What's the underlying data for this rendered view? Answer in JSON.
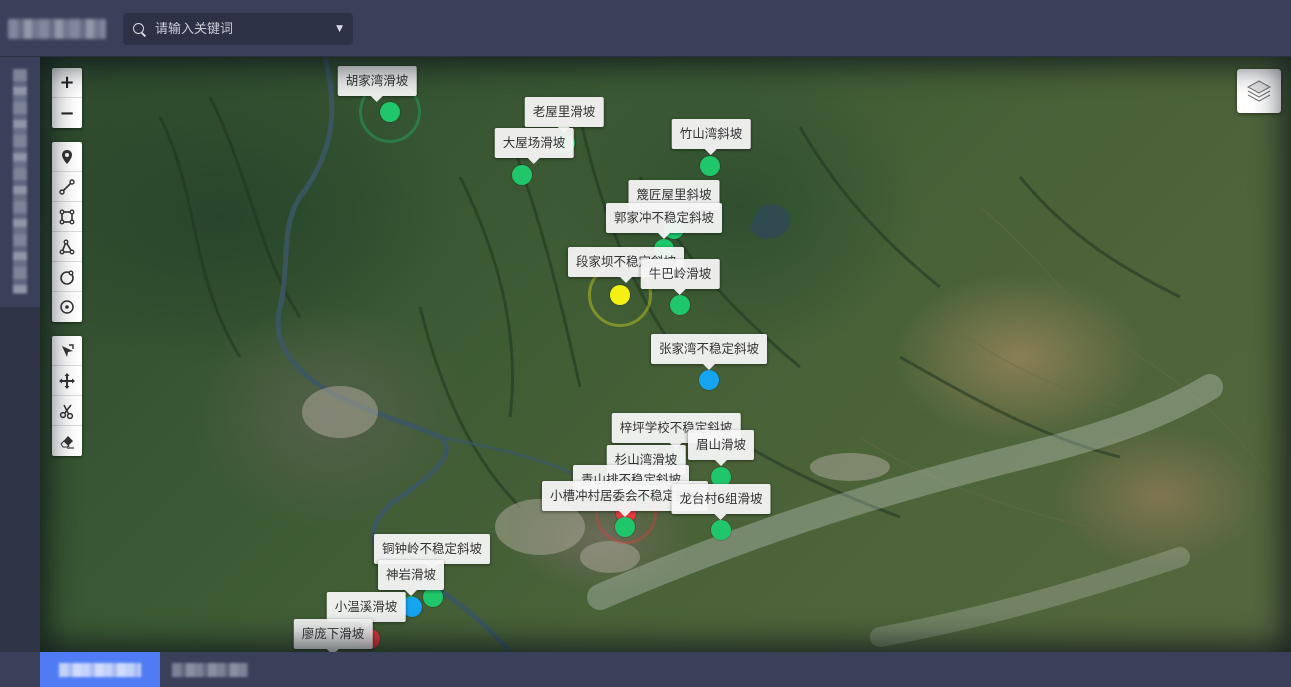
{
  "search": {
    "placeholder": "请输入关键词"
  },
  "map_controls": {
    "zoom": [
      "zoom-in",
      "zoom-out"
    ],
    "draw_tools": [
      "point",
      "line",
      "rectangle",
      "polygon",
      "circle",
      "circle-point"
    ],
    "edit_tools": [
      "select",
      "move",
      "cut",
      "erase"
    ]
  },
  "markers": [
    {
      "name": "胡家湾滑坡",
      "status": "green"
    },
    {
      "name": "老屋里滑坡",
      "status": "green"
    },
    {
      "name": "大屋场滑坡",
      "status": "green"
    },
    {
      "name": "竹山湾斜坡",
      "status": "green"
    },
    {
      "name": "篾匠屋里斜坡",
      "status": "green"
    },
    {
      "name": "郭家冲不稳定斜坡",
      "status": "green"
    },
    {
      "name": "段家坝不稳定斜坡",
      "status": "yellow"
    },
    {
      "name": "牛巴岭滑坡",
      "status": "green"
    },
    {
      "name": "张家湾不稳定斜坡",
      "status": "blue"
    },
    {
      "name": "梓坪学校不稳定斜坡",
      "status": "green"
    },
    {
      "name": "眉山滑坡",
      "status": "green"
    },
    {
      "name": "杉山湾滑坡",
      "status": "green"
    },
    {
      "name": "青山排不稳定斜坡",
      "status": "red"
    },
    {
      "name": "小槽冲村居委会不稳定斜坡",
      "status": "green"
    },
    {
      "name": "龙台村6组滑坡",
      "status": "green"
    },
    {
      "name": "铜钟岭不稳定斜坡",
      "status": "green"
    },
    {
      "name": "神岩滑坡",
      "status": "green"
    },
    {
      "name": "小温溪滑坡",
      "status": "blue"
    },
    {
      "name": "廖庞下滑坡",
      "status": "red"
    }
  ],
  "colors": {
    "green": "#1fc66a",
    "yellow": "#f5f014",
    "blue": "#15a4f0",
    "red": "#e8383d",
    "accent": "#4f7cf5"
  }
}
